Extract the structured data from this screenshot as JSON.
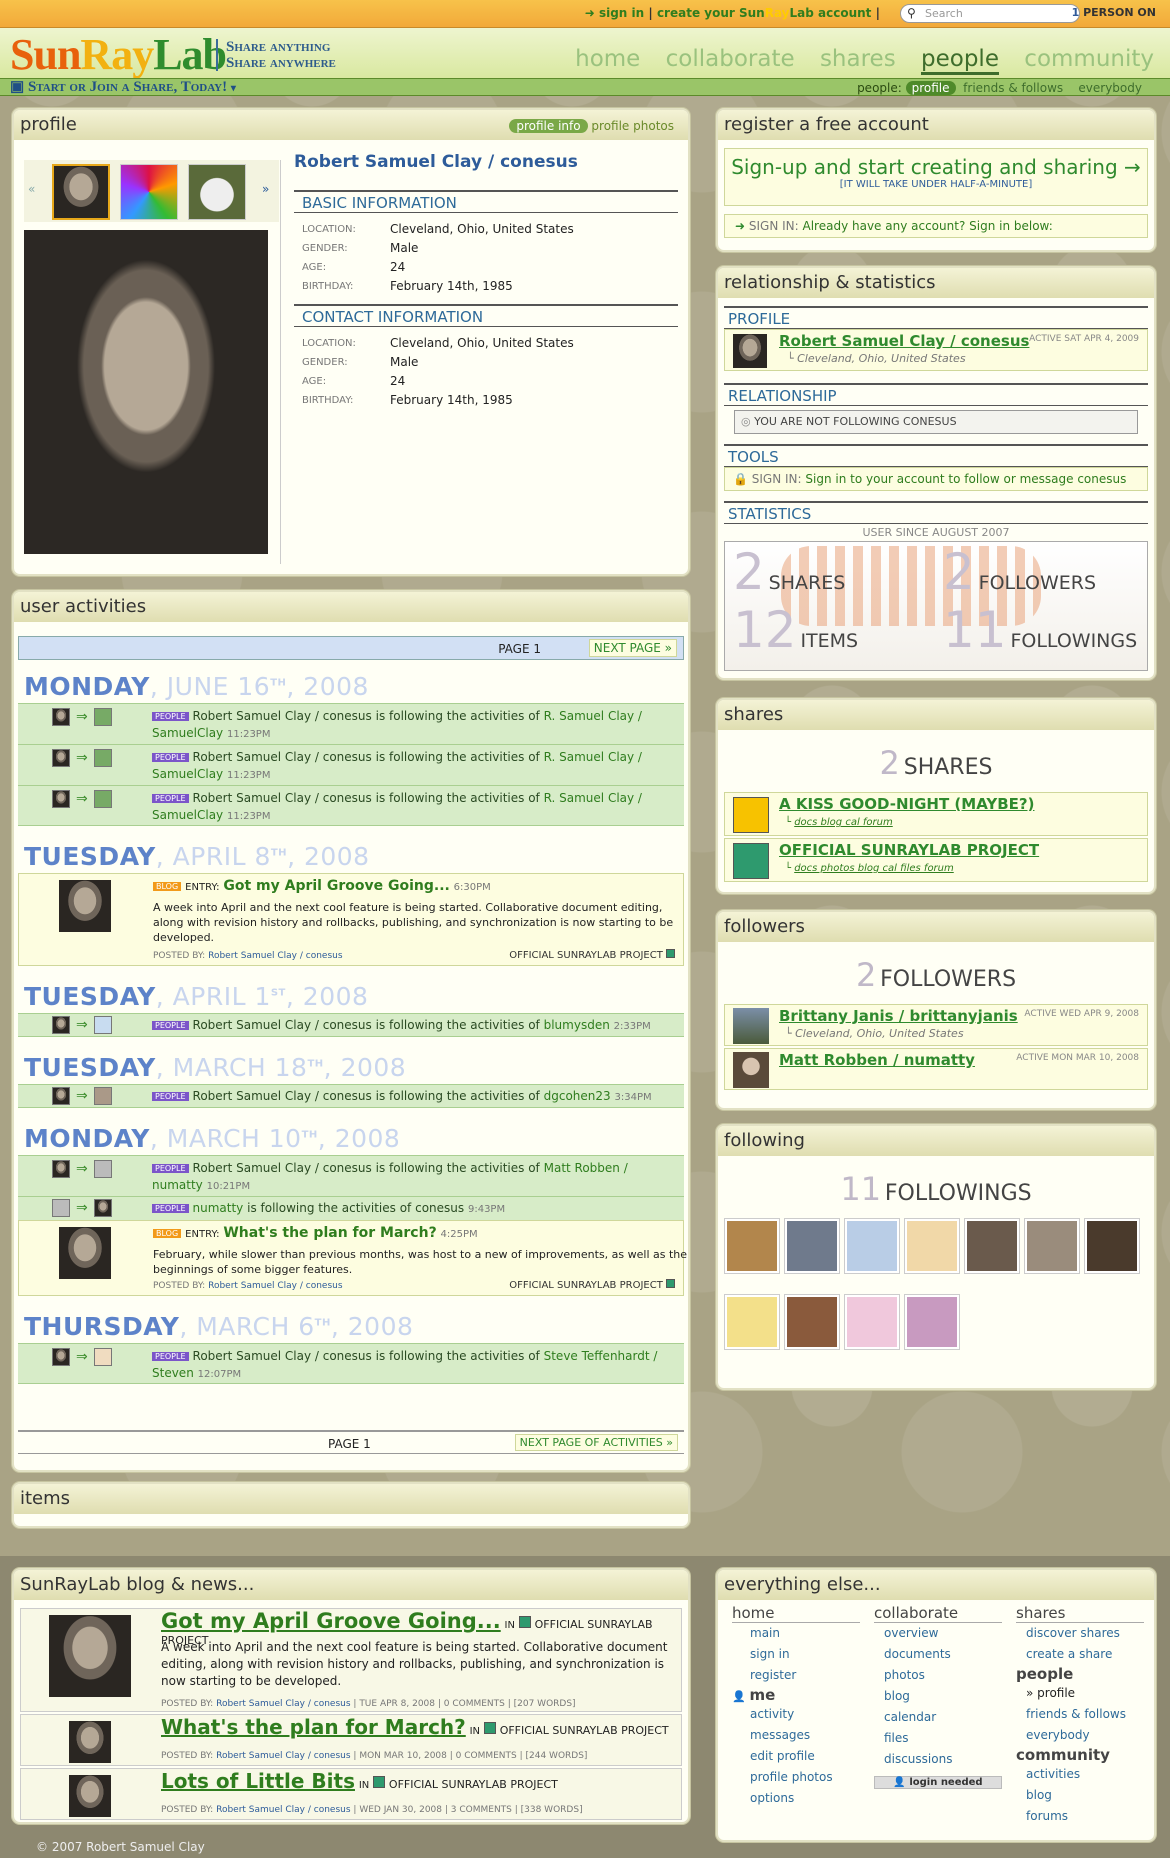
{
  "topbar": {
    "sign_in": "sign in",
    "sep": "|",
    "create_pre": "create your ",
    "brand_a": "Sun",
    "brand_b": "Ray",
    "brand_c": "Lab",
    "create_post": " account",
    "search_placeholder": "Search",
    "online_count": "1",
    "online_label": "PERSON ON"
  },
  "header": {
    "logo_a": "Sun",
    "logo_b": "Ray",
    "logo_c": "Lab",
    "tag1": "Share anything",
    "tag2": "Share anywhere",
    "nav": [
      "home",
      "collaborate",
      "shares",
      "people",
      "community"
    ]
  },
  "subbar": {
    "start": "Start or Join a Share, Today!",
    "people_label": "people:",
    "items": [
      "profile",
      "friends & follows",
      "everybody"
    ]
  },
  "profile": {
    "title": "profile",
    "tab_info": "profile info",
    "tab_photos": "profile photos",
    "name": "Robert Samuel Clay / conesus",
    "basic_title": "BASIC INFORMATION",
    "contact_title": "CONTACT INFORMATION",
    "fields": [
      {
        "k": "LOCATION:",
        "v": "Cleveland, Ohio, United States"
      },
      {
        "k": "GENDER:",
        "v": "Male"
      },
      {
        "k": "AGE:",
        "v": "24"
      },
      {
        "k": "BIRTHDAY:",
        "v": "February 14th, 1985"
      }
    ]
  },
  "register": {
    "title": "register a free account",
    "signup": "Sign-up and start creating and sharing →",
    "signup_sub": "[IT WILL TAKE UNDER HALF-A-MINUTE]",
    "sign_in_label": "SIGN IN:",
    "sign_in_text": "Already have any account? Sign in below:"
  },
  "relationship": {
    "title": "relationship & statistics",
    "profile_label": "PROFILE",
    "name": "Robert Samuel Clay / conesus",
    "loc": "Cleveland, Ohio, United States",
    "active": "ACTIVE SAT APR 4, 2009",
    "rel_label": "RELATIONSHIP",
    "rel_text": "YOU ARE NOT FOLLOWING CONESUS",
    "tools_label": "TOOLS",
    "tools_sign": "SIGN IN:",
    "tools_text": "Sign in to your account to follow or message conesus",
    "stats_label": "STATISTICS",
    "since": "USER SINCE AUGUST 2007",
    "stats": [
      {
        "n": "2",
        "l": "SHARES"
      },
      {
        "n": "2",
        "l": "FOLLOWERS"
      },
      {
        "n": "12",
        "l": "ITEMS"
      },
      {
        "n": "11",
        "l": "FOLLOWINGS"
      }
    ]
  },
  "activities": {
    "title": "user activities",
    "page": "PAGE 1",
    "next": "NEXT PAGE",
    "next_bottom": "NEXT PAGE OF ACTIVITIES",
    "follow_text": "is following the activities of",
    "people_tag": "PEOPLE",
    "blog_tag": "BLOG",
    "entry": "ENTRY:",
    "posted_by": "POSTED BY:",
    "user": "Robert Samuel Clay / conesus",
    "project": "OFFICIAL SUNRAYLAB PROJECT",
    "days": [
      {
        "d": "MONDAY",
        "m": ", JUNE 16",
        "s": "TH",
        "y": ", 2008"
      },
      {
        "d": "TUESDAY",
        "m": ", APRIL 8",
        "s": "TH",
        "y": ", 2008"
      },
      {
        "d": "TUESDAY",
        "m": ", APRIL 1",
        "s": "ST",
        "y": ", 2008"
      },
      {
        "d": "TUESDAY",
        "m": ", MARCH 18",
        "s": "TH",
        "y": ", 2008"
      },
      {
        "d": "MONDAY",
        "m": ", MARCH 10",
        "s": "TH",
        "y": ", 2008"
      },
      {
        "d": "THURSDAY",
        "m": ", MARCH 6",
        "s": "TH",
        "y": ", 2008"
      }
    ],
    "rows": {
      "a1": {
        "who": "R. Samuel Clay / SamuelClay",
        "t": "11:23PM"
      },
      "b1": {
        "title": "Got my April Groove Going...",
        "t": "6:30PM",
        "body": "A week into April and the next cool feature is being started. Collaborative document editing, along with revision history and rollbacks, publishing, and synchronization is now starting to be developed."
      },
      "c1": {
        "who": "blumysden",
        "t": "2:33PM"
      },
      "d1": {
        "who": "dgcohen23",
        "t": "3:34PM"
      },
      "e1": {
        "who": "Matt Robben / numatty",
        "t": "10:21PM"
      },
      "e2": {
        "actor": "numatty",
        "who": "conesus",
        "t": "9:43PM"
      },
      "e3": {
        "title": "What's the plan for March?",
        "t": "4:25PM",
        "body": "February, while slower than previous months, was host to a new of improvements, as well as the beginnings of some bigger features."
      },
      "f1": {
        "who": "Steve Teffenhardt / Steven",
        "t": "12:07PM"
      }
    }
  },
  "items": {
    "title": "items"
  },
  "shares": {
    "title": "shares",
    "count": "2",
    "label": "SHARES",
    "list": [
      {
        "name": "A KISS GOOD-NIGHT (MAYBE?)",
        "links": "docs  blog  cal  forum",
        "color": "#f7c200"
      },
      {
        "name": "OFFICIAL SUNRAYLAB PROJECT",
        "links": "docs  photos  blog  cal  files  forum",
        "color": "#2e9a6e"
      }
    ]
  },
  "followers": {
    "title": "followers",
    "count": "2",
    "label": "FOLLOWERS",
    "list": [
      {
        "name": "Brittany Janis / brittanyjanis",
        "loc": "Cleveland, Ohio, United States",
        "active": "ACTIVE WED APR 9, 2008"
      },
      {
        "name": "Matt Robben / numatty",
        "active": "ACTIVE MON MAR 10, 2008"
      }
    ]
  },
  "following": {
    "title": "following",
    "count": "11",
    "label": "FOLLOWINGS",
    "colors": [
      "#b2864c",
      "#6f7a8c",
      "#b9cde6",
      "#f1d8a8",
      "#6a5a4c",
      "#9a8c7c",
      "#4a3a2c",
      "#f3e08a",
      "#8a5a3c",
      "#f0c8dc",
      "#c89ac0"
    ]
  },
  "blog": {
    "title": "SunRayLab blog & news...",
    "in": "IN",
    "project": "OFFICIAL SUNRAYLAB PROJECT",
    "posted": "POSTED BY:",
    "user": "Robert Samuel Clay / conesus",
    "posts": [
      {
        "title": "Got my April Groove Going...",
        "body": "A week into April and the next cool feature is being started. Collaborative document editing, along with revision history and rollbacks, publishing, and synchronization is now starting to be developed.",
        "meta": "TUE APR 8, 2008 | 0 COMMENTS | [207 WORDS]"
      },
      {
        "title": "What's the plan for March?",
        "meta": "MON MAR 10, 2008 | 0 COMMENTS | [244 WORDS]"
      },
      {
        "title": "Lots of Little Bits",
        "meta": "WED JAN 30, 2008 | 3 COMMENTS | [338 WORDS]"
      }
    ]
  },
  "else": {
    "title": "everything else...",
    "home": "home",
    "home_items": [
      "main",
      "sign in",
      "register"
    ],
    "me": "me",
    "me_items": [
      "activity",
      "messages",
      "edit profile",
      "profile photos",
      "options"
    ],
    "collab": "collaborate",
    "collab_items": [
      "overview",
      "documents",
      "photos",
      "blog",
      "calendar",
      "files",
      "discussions"
    ],
    "login": "login needed",
    "shares": "shares",
    "shares_items": [
      "discover shares",
      "create a share"
    ],
    "people": "people",
    "people_items": [
      "profile",
      "friends & follows",
      "everybody"
    ],
    "community": "community",
    "community_items": [
      "activities",
      "blog",
      "forums"
    ]
  },
  "copyright": "© 2007 Robert Samuel Clay"
}
